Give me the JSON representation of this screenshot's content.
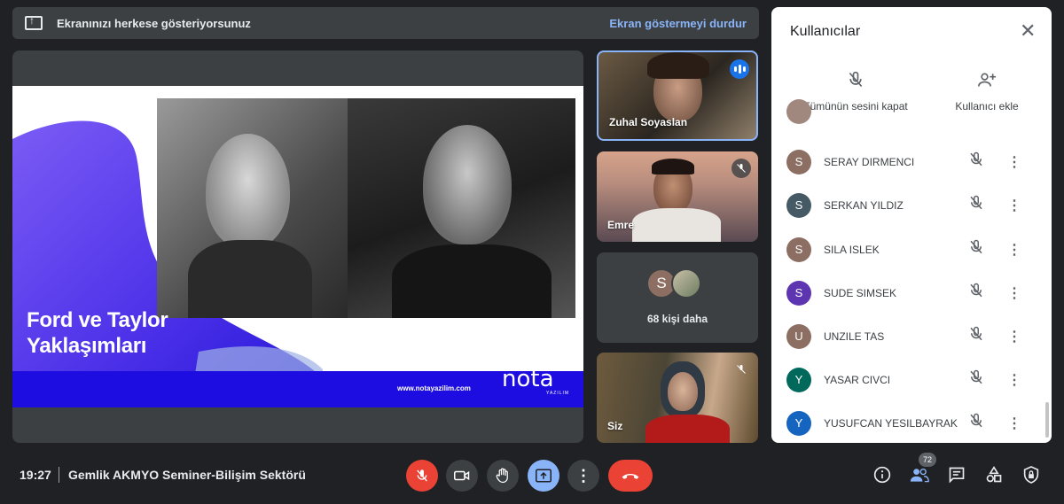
{
  "banner": {
    "message": "Ekranınızı herkese gösteriyorsunuz",
    "stop_label": "Ekran göstermeyi durdur"
  },
  "slide": {
    "title_line1": "Ford ve Taylor",
    "title_line2": "Yaklaşımları",
    "website": "www.notayazilim.com",
    "logo": "nota",
    "logo_sub": "YAZILIM"
  },
  "tiles": [
    {
      "name": "Zuhal Soyaslan",
      "status": "speaking"
    },
    {
      "name": "Emre",
      "status": "muted"
    },
    {
      "name": "",
      "more_label": "68 kişi daha",
      "avatar_letter": "S"
    },
    {
      "name": "Siz",
      "status": "muted"
    }
  ],
  "panel": {
    "title": "Kullanıcılar",
    "mute_all_label": "Tümünün sesini kapat",
    "add_user_label": "Kullanıcı ekle",
    "participants": [
      {
        "letter": "S",
        "name": "SERAY DIRMENCI",
        "color": "#8d6e63"
      },
      {
        "letter": "S",
        "name": "SERKAN YILDIZ",
        "color": "#455a64"
      },
      {
        "letter": "S",
        "name": "SILA ISLEK",
        "color": "#8d6e63"
      },
      {
        "letter": "S",
        "name": "SUDE SIMSEK",
        "color": "#5e35b1"
      },
      {
        "letter": "U",
        "name": "UNZILE TAS",
        "color": "#8d6e63"
      },
      {
        "letter": "Y",
        "name": "YASAR CIVCI",
        "color": "#00695c"
      },
      {
        "letter": "Y",
        "name": "YUSUFCAN YESILBAYRAK",
        "color": "#1565c0"
      }
    ]
  },
  "bottom": {
    "time": "19:27",
    "meeting_title": "Gemlik AKMYO Seminer-Bilişim Sektörü",
    "participant_count": "72"
  },
  "colors": {
    "accent_blue": "#8ab4f8",
    "danger_red": "#ea4335",
    "bg": "#202124",
    "slide_blue": "#1d0de0",
    "slide_purple": "#6a3df0"
  }
}
